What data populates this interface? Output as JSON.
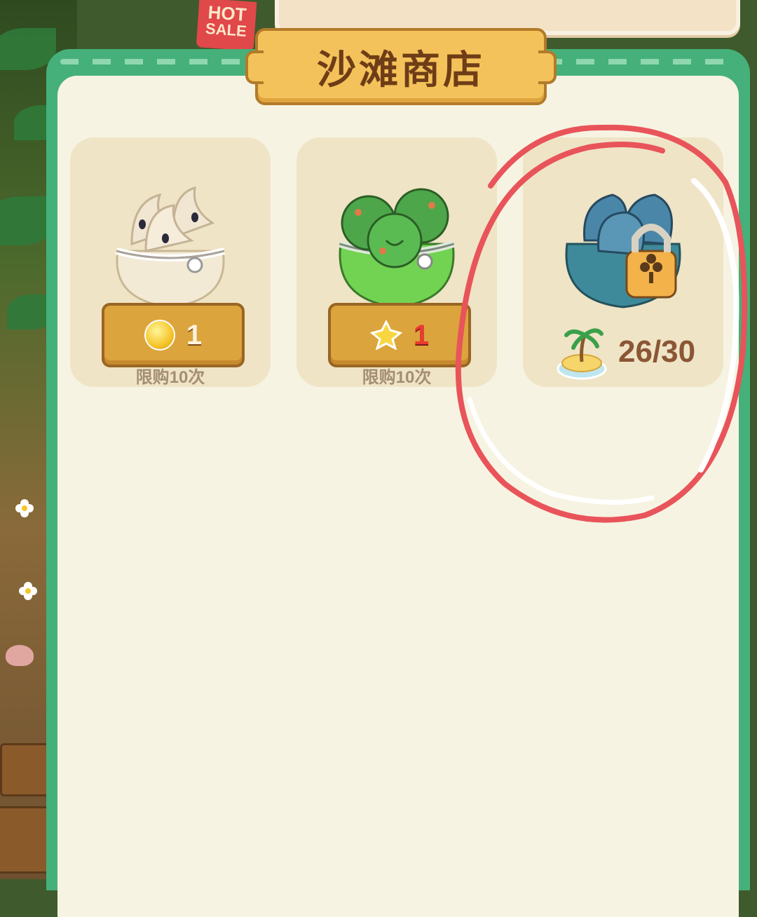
{
  "hot_tag": {
    "line1": "HOT",
    "line2": "SALE"
  },
  "shop": {
    "title": "沙滩商店"
  },
  "cards": [
    {
      "price": "1",
      "currency_icon": "gold-coin-icon",
      "limit": "限购10次"
    },
    {
      "price": "1",
      "currency_icon": "star-dust-icon",
      "limit": "限购10次"
    },
    {
      "progress": "26/30",
      "unlock_icon": "island-icon",
      "locked": true
    }
  ],
  "colors": {
    "panel_green": "#45b07a",
    "panel_inner": "#f7f3e2",
    "title_plate": "#f4c25a",
    "price_button": "#dca43c",
    "red_annotation": "#e8545a"
  }
}
